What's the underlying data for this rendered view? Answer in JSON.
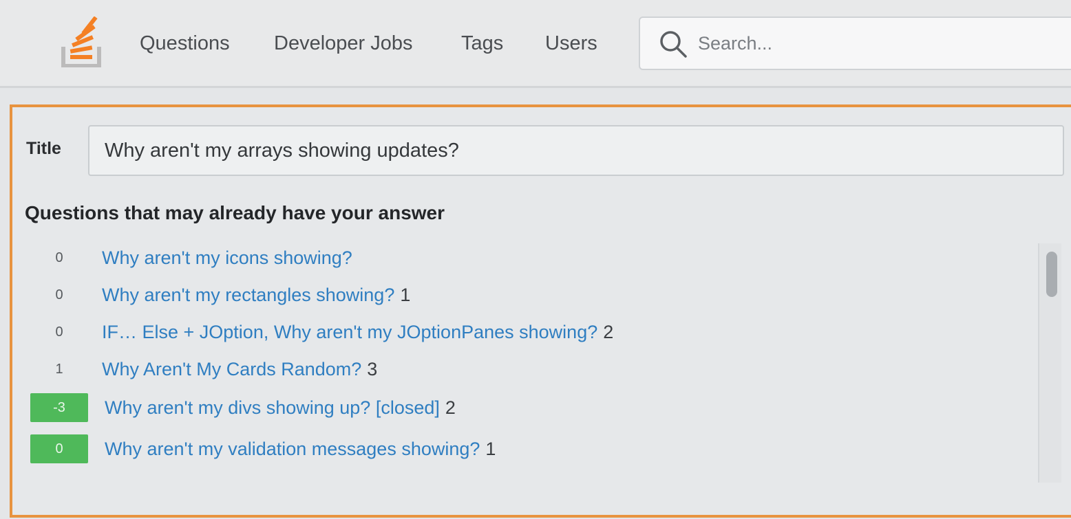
{
  "header": {
    "logo_icon": "stackoverflow-logo-icon",
    "nav": [
      {
        "label": "Questions"
      },
      {
        "label": "Developer Jobs"
      },
      {
        "label": "Tags"
      },
      {
        "label": "Users"
      }
    ],
    "search": {
      "placeholder": "Search...",
      "value": "",
      "icon": "search-icon"
    }
  },
  "ask_form": {
    "title_label": "Title",
    "title_value": "Why aren't my arrays showing updates?",
    "similar_heading": "Questions that may already have your answer",
    "similar_questions": [
      {
        "score": "0",
        "title": "Why aren't my icons showing?",
        "answers": "",
        "accepted": false
      },
      {
        "score": "0",
        "title": "Why aren't my rectangles showing?",
        "answers": "1",
        "accepted": false
      },
      {
        "score": "0",
        "title": "IF… Else + JOption, Why aren't my JOptionPanes showing?",
        "answers": "2",
        "accepted": false
      },
      {
        "score": "1",
        "title": "Why Aren't My Cards Random?",
        "answers": "3",
        "accepted": false
      },
      {
        "score": "-3",
        "title": "Why aren't my divs showing up? [closed]",
        "answers": "2",
        "accepted": true
      },
      {
        "score": "0",
        "title": "Why aren't my validation messages showing?",
        "answers": "1",
        "accepted": true
      }
    ]
  },
  "colors": {
    "accent_border": "#e8933f",
    "link": "#2f7ec1",
    "accepted_badge": "#4fb95a"
  }
}
